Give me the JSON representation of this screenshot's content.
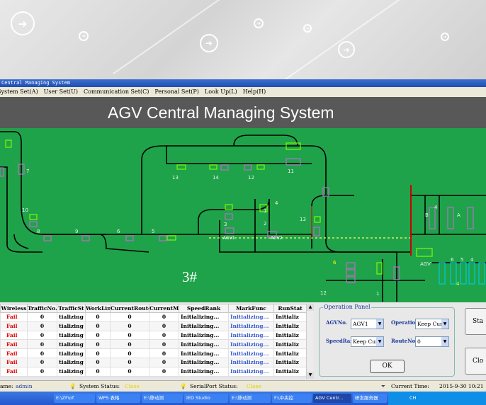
{
  "window": {
    "title": "Central Managing System"
  },
  "menu": [
    "System Set(A)",
    "User Set(U)",
    "Communication Set(C)",
    "Personal Set(P)",
    "Look Up(L)",
    "Help(H)"
  ],
  "header": {
    "title": "AGV Central Managing System"
  },
  "map": {
    "big_label": "3#",
    "node_labels": [
      "13",
      "14",
      "12",
      "11",
      "7",
      "10",
      "8",
      "9",
      "6",
      "5",
      "3",
      "2",
      "1",
      "4",
      "13",
      "6",
      "12",
      "1",
      "B",
      "4",
      "A",
      "AGV",
      "6",
      "5",
      "4",
      "4",
      "AGV1",
      "AGV2"
    ],
    "colors": {
      "background": "#1fa34a",
      "track": "#000000",
      "station": "#b070c0",
      "point": "#7cfc00"
    }
  },
  "table": {
    "columns": [
      "Wireless",
      "TrafficNo.",
      "TrafficSt",
      "WorkLine",
      "CurrentRoute",
      "CurrentMark",
      "SpeedRank",
      "MarkFunc",
      "RunStat"
    ],
    "rows": [
      [
        "Fail",
        "0",
        "tializing",
        "0",
        "0",
        "0",
        "Initializing...",
        "Initializing...",
        "Initializ"
      ],
      [
        "Fail",
        "0",
        "tializing",
        "0",
        "0",
        "0",
        "Initializing...",
        "Initializing...",
        "Initializ"
      ],
      [
        "Fail",
        "0",
        "tializing",
        "0",
        "0",
        "0",
        "Initializing...",
        "Initializing...",
        "Initializ"
      ],
      [
        "Fail",
        "0",
        "tializing",
        "0",
        "0",
        "0",
        "Initializing...",
        "Initializing...",
        "Initializ"
      ],
      [
        "Fail",
        "0",
        "tializing",
        "0",
        "0",
        "0",
        "Initializing...",
        "Initializing...",
        "Initializ"
      ],
      [
        "Fail",
        "0",
        "tializing",
        "0",
        "0",
        "0",
        "Initializing...",
        "Initializing...",
        "Initializ"
      ],
      [
        "Fail",
        "0",
        "tializing",
        "0",
        "0",
        "0",
        "Initializing...",
        "Initializing...",
        "Initializ"
      ]
    ]
  },
  "operation_panel": {
    "legend": "Operation Panel",
    "agv_no_label": "AGVNo.",
    "agv_no_value": "AGV1",
    "operation_label": "Operation",
    "operation_value": "Keep Cur",
    "speed_rank_label": "SpeedRank",
    "speed_rank_value": "Keep Cur",
    "route_no_label": "RouteNo.",
    "route_no_value": "0",
    "ok_label": "OK"
  },
  "side_buttons": {
    "start": "Sta",
    "close": "Clo"
  },
  "status_bar": {
    "user_label": "ame:",
    "user_value": "admin",
    "system_status_label": "System Status:",
    "system_status_value": "Close",
    "serial_port_label": "SerialPort Status:",
    "serial_port_value": "Close",
    "current_time_label": "Current Time:",
    "current_time_value": "2015-9-30 10:21"
  },
  "taskbar": {
    "items": [
      "E:\\ZF\\of",
      "WPS 表格",
      "E:\\移动测",
      "IED Studio",
      "E:\\移动测",
      "F:\\中央控",
      "AGV Centr...",
      "研发服务器"
    ],
    "tray": "CH"
  }
}
